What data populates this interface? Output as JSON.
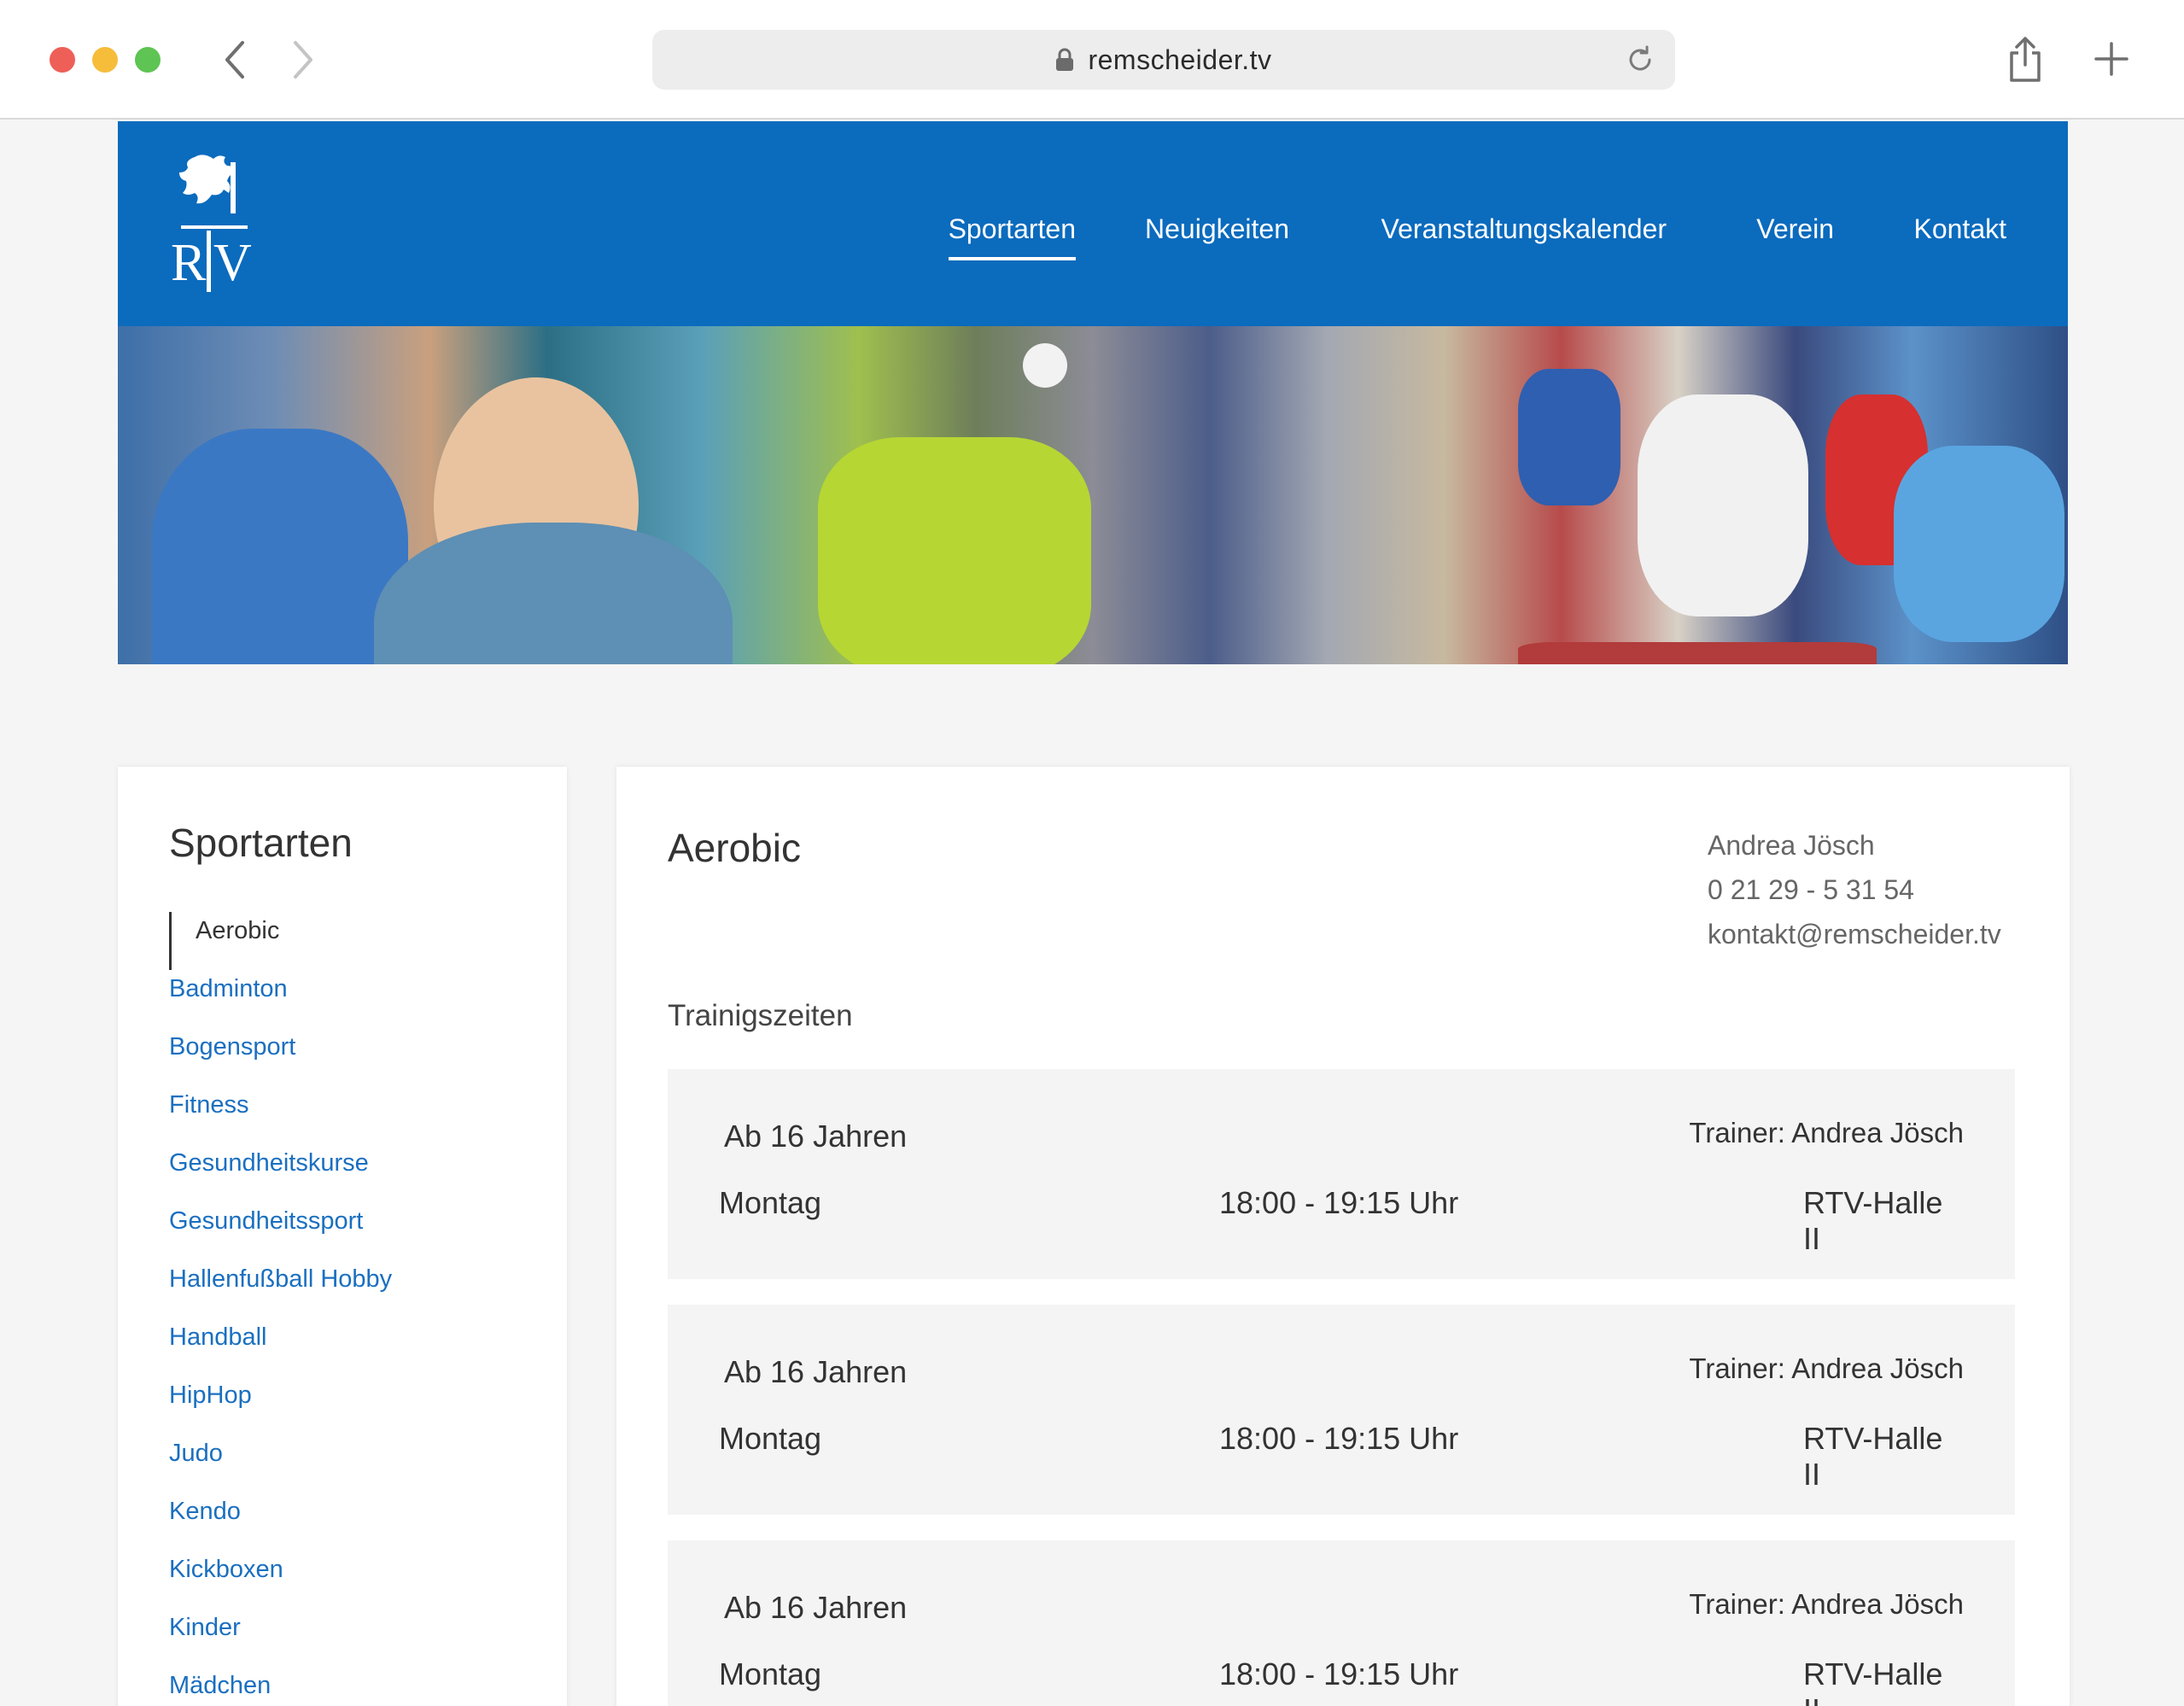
{
  "browser": {
    "url": "remscheider.tv"
  },
  "site": {
    "logo_text": "RTV",
    "nav": [
      {
        "label": "Sportarten",
        "active": true
      },
      {
        "label": "Neuigkeiten",
        "active": false
      },
      {
        "label": "Veranstaltungskalender",
        "active": false
      },
      {
        "label": "Verein",
        "active": false
      },
      {
        "label": "Kontakt",
        "active": false
      }
    ],
    "colors": {
      "header": "#0b6bbd",
      "link": "#1a6fc0"
    }
  },
  "sidebar": {
    "title": "Sportarten",
    "items": [
      "Aerobic",
      "Badminton",
      "Bogensport",
      "Fitness",
      "Gesundheitskurse",
      "Gesundheitssport",
      "Hallenfußball Hobby",
      "Handball",
      "HipHop",
      "Judo",
      "Kendo",
      "Kickboxen",
      "Kinder",
      "Mädchen"
    ],
    "current": "Aerobic"
  },
  "main": {
    "title": "Aerobic",
    "contact": {
      "name": "Andrea Jösch",
      "phone": "0 21 29 - 5 31 54",
      "email": "kontakt@remscheider.tv"
    },
    "section_title": "Trainigszeiten",
    "sessions": [
      {
        "age": "Ab 16 Jahren",
        "trainer": "Trainer: Andrea Jösch",
        "day": "Montag",
        "time": "18:00 - 19:15 Uhr",
        "place": "RTV-Halle II"
      },
      {
        "age": "Ab 16 Jahren",
        "trainer": "Trainer: Andrea Jösch",
        "day": "Montag",
        "time": "18:00 - 19:15 Uhr",
        "place": "RTV-Halle II"
      },
      {
        "age": "Ab 16 Jahren",
        "trainer": "Trainer: Andrea Jösch",
        "day": "Montag",
        "time": "18:00 - 19:15 Uhr",
        "place": "RTV-Halle II"
      }
    ]
  }
}
